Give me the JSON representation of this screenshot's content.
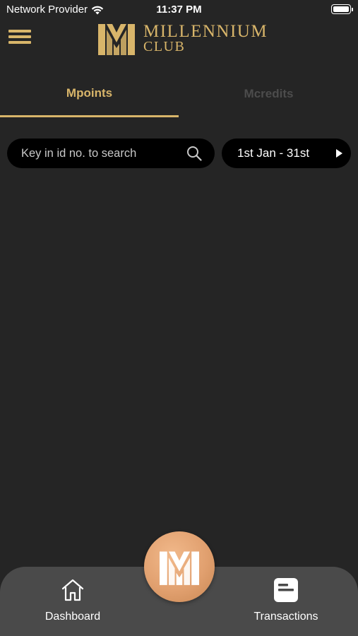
{
  "status_bar": {
    "carrier": "Network Provider",
    "time": "11:37 PM"
  },
  "header": {
    "logo_line1": "MILLENNIUM",
    "logo_line2": "CLUB"
  },
  "tabs": [
    {
      "label": "Mpoints",
      "active": true
    },
    {
      "label": "Mcredits",
      "active": false
    }
  ],
  "search": {
    "placeholder": "Key in id no. to search",
    "value": ""
  },
  "date_range": {
    "label": "1st Jan - 31st"
  },
  "bottom_nav": {
    "dashboard_label": "Dashboard",
    "transactions_label": "Transactions",
    "center_icon": "mm-logo-icon"
  },
  "colors": {
    "background": "#252525",
    "accent": "#d8b56a",
    "tab_bar": "#4a4a4a",
    "center_button": "#e1a06f",
    "inactive_tab": "#4c4c4c"
  }
}
